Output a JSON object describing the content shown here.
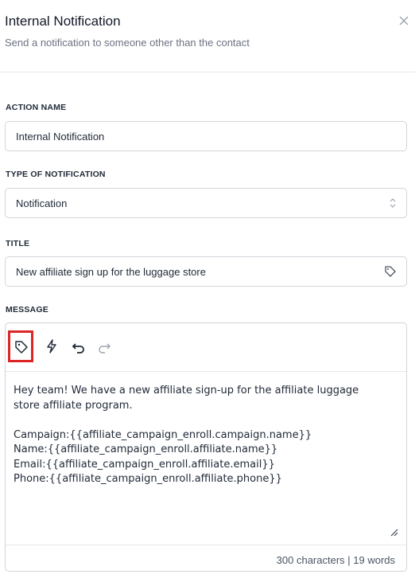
{
  "header": {
    "title": "Internal Notification",
    "subtitle": "Send a notification to someone other than the contact",
    "close_icon": "close-icon"
  },
  "action_name": {
    "label": "ACTION NAME",
    "value": "Internal Notification"
  },
  "notification_type": {
    "label": "TYPE OF NOTIFICATION",
    "value": "Notification"
  },
  "title_field": {
    "label": "TITLE",
    "value": "New affiliate sign up for the luggage store"
  },
  "message": {
    "label": "MESSAGE",
    "toolbar": [
      "tag-icon",
      "lightning-icon",
      "undo-icon",
      "redo-icon"
    ],
    "highlight_color": "#dc2626",
    "body": "Hey team! We have a new affiliate sign-up for the affiliate luggage\nstore affiliate program.\n\nCampaign:{{affiliate_campaign_enroll.campaign.name}}\nName:{{affiliate_campaign_enroll.affiliate.name}}\nEmail:{{affiliate_campaign_enroll.affiliate.email}}\nPhone:{{affiliate_campaign_enroll.affiliate.phone}}",
    "counter": "300 characters | 19 words"
  }
}
